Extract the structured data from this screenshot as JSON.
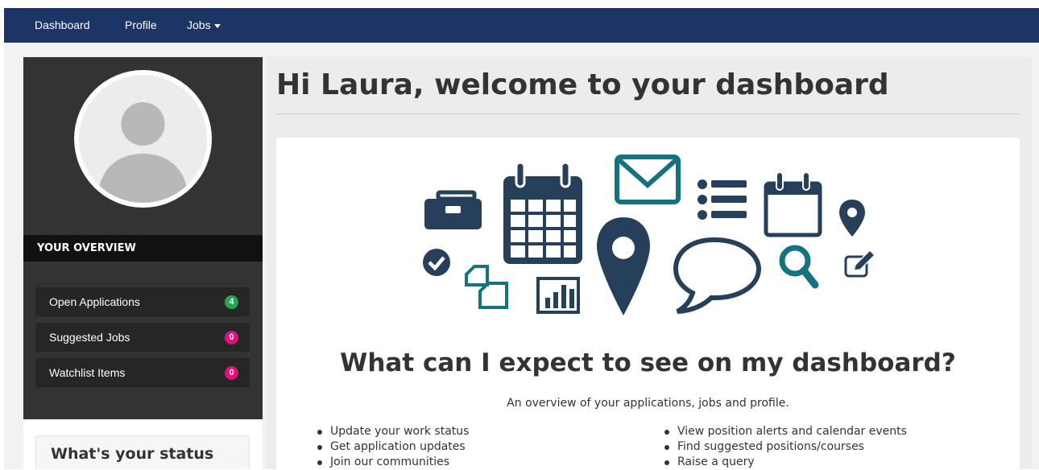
{
  "navbar": {
    "items": [
      "Dashboard",
      "Profile",
      "Jobs"
    ],
    "background": "#1c3466"
  },
  "sidebar": {
    "overview_title": "YOUR OVERVIEW",
    "items": [
      {
        "label": "Open Applications",
        "count": "4",
        "badge_color": "#1fa84f"
      },
      {
        "label": "Suggested Jobs",
        "count": "0",
        "badge_color": "#e0107a"
      },
      {
        "label": "Watchlist Items",
        "count": "0",
        "badge_color": "#e0107a"
      }
    ],
    "status_title": "What's your status"
  },
  "main": {
    "title": "Hi Laura, welcome to your dashboard",
    "subtitle": "What can I expect to see on my dashboard?",
    "lead": "An overview of your applications, jobs and profile.",
    "features_left": [
      "Update your work status",
      "Get application updates",
      "Join our communities"
    ],
    "features_right": [
      "View position alerts and calendar events",
      "Find suggested positions/courses",
      "Raise a query"
    ]
  },
  "illustration": {
    "icons": [
      "briefcase-icon",
      "calendar-icon",
      "envelope-icon",
      "list-icon",
      "calendar-outline-icon",
      "map-marker-small-icon",
      "check-circle-icon",
      "copy-icon",
      "bar-chart-icon",
      "map-marker-icon",
      "speech-bubble-icon",
      "search-icon",
      "edit-icon"
    ],
    "dark_color": "#263f5a",
    "teal_color": "#15727f"
  }
}
